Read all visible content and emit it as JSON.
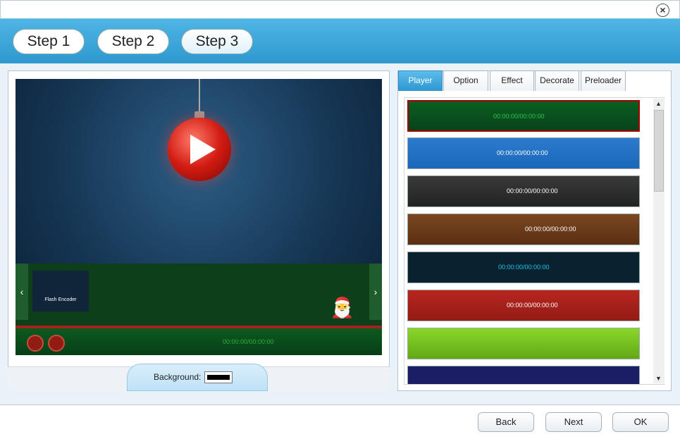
{
  "window": {
    "close_icon": "close-icon"
  },
  "steps": [
    {
      "label": "Step 1"
    },
    {
      "label": "Step 2"
    },
    {
      "label": "Step 3"
    }
  ],
  "preview": {
    "thumbnail_text": "Flash Encoder",
    "player_time": "00:00:00/00:00:00",
    "background_label": "Background:",
    "background_color": "#000000"
  },
  "tabs": [
    {
      "label": "Player"
    },
    {
      "label": "Option"
    },
    {
      "label": "Effect"
    },
    {
      "label": "Decorate"
    },
    {
      "label": "Preloader"
    }
  ],
  "skins": [
    {
      "time": "00:00:00/00:00:00",
      "colors": {
        "bg": "#0b5f23",
        "accent": "#a21d18",
        "text": "#30c24b"
      }
    },
    {
      "time": "00:00:00/00:00:00",
      "colors": {
        "bg": "#1a67b8",
        "accent": "#6ab7f0",
        "text": "#ffffff"
      }
    },
    {
      "time": "00:00:00/00:00:00",
      "colors": {
        "bg": "#2b2b2b",
        "accent": "#5d5d5d",
        "text": "#ffffff"
      }
    },
    {
      "time": "00:00:00/00:00:00",
      "colors": {
        "bg": "#6b3b1b",
        "accent": "#b88a4e",
        "text": "#ffffff"
      }
    },
    {
      "time": "00:00:00/00:00:00",
      "colors": {
        "bg": "#0a2230",
        "accent": "#16bfe9",
        "text": "#17c6ef"
      }
    },
    {
      "time": "00:00:00/00:00:00",
      "colors": {
        "bg": "#a41e1a",
        "accent": "#e3e3e3",
        "text": "#ffffff"
      }
    },
    {
      "time": "",
      "colors": {
        "bg": "#77c421",
        "accent": "#4f8e12",
        "text": "#ffffff"
      }
    },
    {
      "time": "",
      "colors": {
        "bg": "#1b1e64",
        "accent": "#ffffff",
        "text": "#ffffff"
      }
    }
  ],
  "footer": {
    "back": "Back",
    "next": "Next",
    "ok": "OK"
  }
}
